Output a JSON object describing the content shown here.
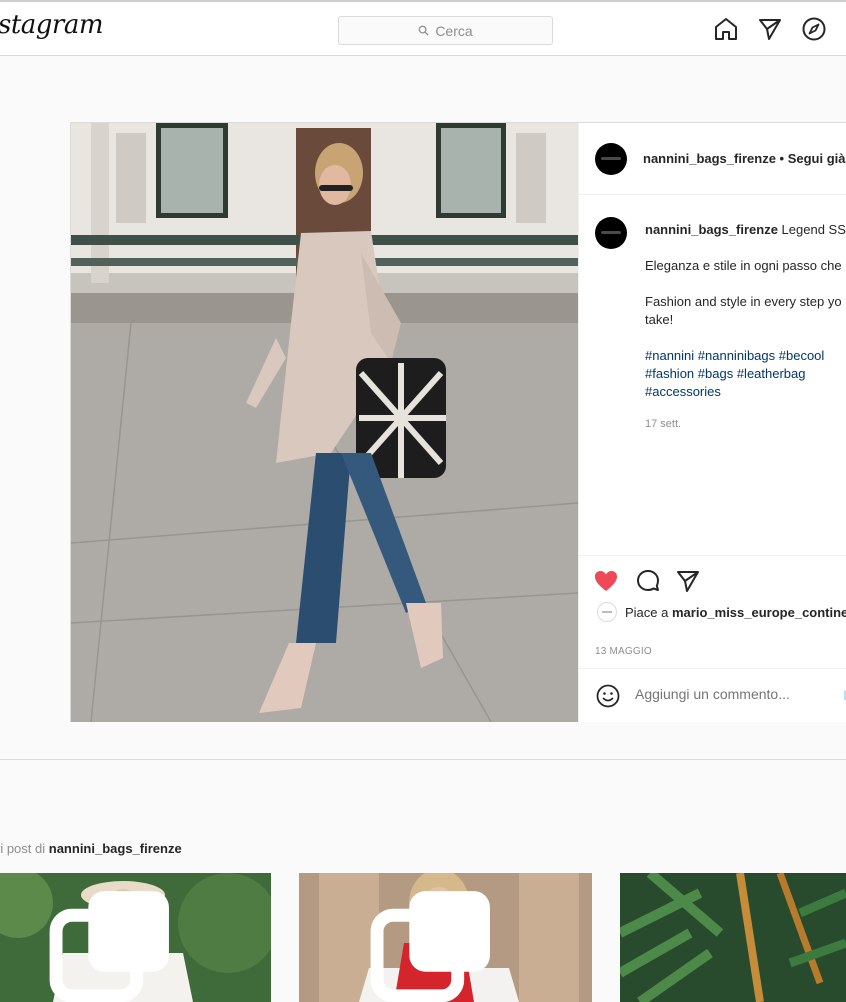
{
  "nav": {
    "logo": "stagram",
    "search_placeholder": "Cerca",
    "icons": [
      "home-icon",
      "direct-icon",
      "explore-icon"
    ]
  },
  "post": {
    "username": "nannini_bags_firenze",
    "follow_text": "• Segui già",
    "caption": {
      "username": "nannini_bags_firenze",
      "title": "Legend SS",
      "line_it": "Eleganza e stile in ogni passo che",
      "line_en": "Fashion and style in every step yo take!",
      "hashtags": [
        "#nannini",
        "#nanninibags",
        "#becool",
        "#fashion",
        "#bags",
        "#leatherbag",
        "#accessories"
      ],
      "time": "17 sett."
    },
    "likes_prefix": "Piace a",
    "likes_user": "mario_miss_europe_contine",
    "date": "13 MAGGIO",
    "comment_placeholder": "Aggiungi un commento...",
    "publish_label": "P",
    "colors": {
      "like": "#ed4956",
      "hashtag": "#00376b"
    }
  },
  "more": {
    "prefix": "ri post di",
    "username": "nannini_bags_firenze"
  }
}
